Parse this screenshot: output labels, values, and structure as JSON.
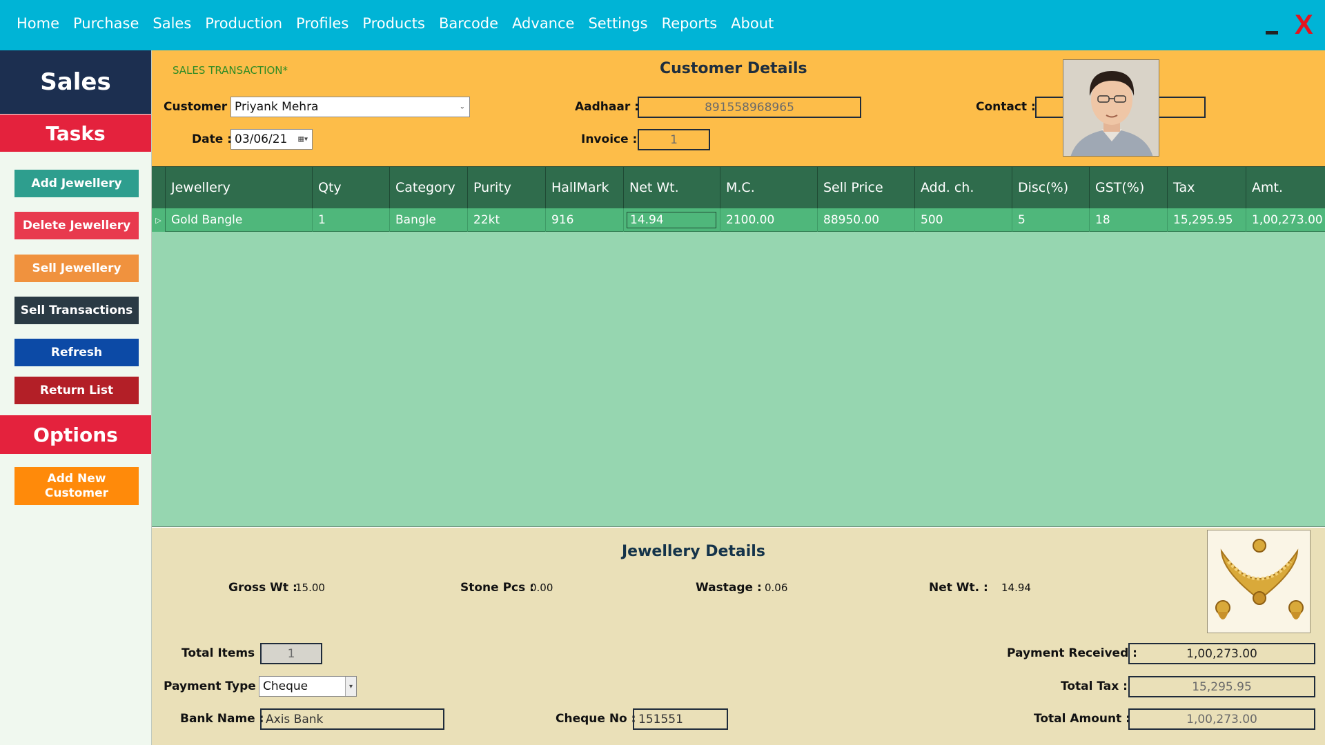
{
  "menu": [
    "Home",
    "Purchase",
    "Sales",
    "Production",
    "Profiles",
    "Products",
    "Barcode",
    "Advance",
    "Settings",
    "Reports",
    "About"
  ],
  "window": {
    "close_label": "X"
  },
  "sidebar": {
    "title": "Sales",
    "tasks_title": "Tasks",
    "buttons": [
      "Add Jewellery",
      "Delete Jewellery",
      "Sell Jewellery",
      "Sell Transactions",
      "Refresh",
      "Return List"
    ],
    "options_title": "Options",
    "options_button": "Add New Customer"
  },
  "customer": {
    "transaction_label": "SALES TRANSACTION*",
    "section_title": "Customer Details",
    "customer_label": "Customer :",
    "customer_value": "Priyank Mehra",
    "date_label": "Date :",
    "date_value": "03/06/21",
    "aadhaar_label": "Aadhaar :",
    "aadhaar_value": "891558968965",
    "invoice_label": "Invoice :",
    "invoice_value": "1",
    "contact_label": "Contact :",
    "contact_value": "8498489885"
  },
  "grid": {
    "columns": [
      "Jewellery",
      "Qty",
      "Category",
      "Purity",
      "HallMark",
      "Net Wt.",
      "M.C.",
      "Sell Price",
      "Add. ch.",
      "Disc(%)",
      "GST(%)",
      "Tax",
      "Amt."
    ],
    "rows": [
      [
        "Gold Bangle",
        "1",
        "Bangle",
        "22kt",
        "916",
        "14.94",
        "2100.00",
        "88950.00",
        "500",
        "5",
        "18",
        "15,295.95",
        "1,00,273.00"
      ]
    ]
  },
  "jewellery": {
    "section_title": "Jewellery Details",
    "gross_wt_label": "Gross Wt :",
    "gross_wt_value": "15.00",
    "stone_pcs_label": "Stone Pcs :",
    "stone_pcs_value": "0.00",
    "wastage_label": "Wastage :",
    "wastage_value": "0.06",
    "net_wt_label": "Net Wt. :",
    "net_wt_value": "14.94"
  },
  "summary": {
    "total_items_label": "Total Items :",
    "total_items_value": "1",
    "payment_type_label": "Payment Type :",
    "payment_type_value": "Cheque",
    "bank_name_label": "Bank Name :",
    "bank_name_value": "Axis Bank",
    "cheque_no_label": "Cheque No :",
    "cheque_no_value": "151551",
    "payment_received_label": "Payment Received :",
    "payment_received_value": "1,00,273.00",
    "total_tax_label": "Total Tax :",
    "total_tax_value": "15,295.95",
    "total_amount_label": "Total Amount :",
    "total_amount_value": "1,00,273.00"
  },
  "colors": {
    "menubar": "#00b4d6",
    "sidebar_header": "#1c2f50",
    "section_red": "#e4223d",
    "customer_panel": "#fdbd49",
    "grid_header": "#2f6c4c",
    "grid_row": "#4fb77b",
    "grid_bg": "#96d6b0",
    "details_bg": "#eae0b8"
  }
}
